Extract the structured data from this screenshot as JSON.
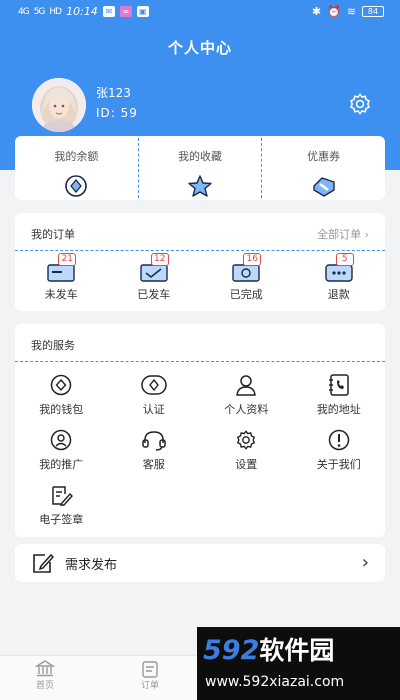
{
  "status_bar": {
    "signal_1": "4G",
    "signal_2": "5G",
    "badge_hd": "HD",
    "time": "10:14",
    "battery": "84"
  },
  "header": {
    "title": "个人中心",
    "username": "张123",
    "user_id": "ID: 59"
  },
  "quick_links": [
    {
      "label": "我的余额",
      "icon": "diamond-icon"
    },
    {
      "label": "我的收藏",
      "icon": "star-icon"
    },
    {
      "label": "优惠券",
      "icon": "coupon-icon"
    }
  ],
  "orders": {
    "title": "我的订单",
    "more": "全部订单",
    "items": [
      {
        "label": "未发车",
        "count": "21"
      },
      {
        "label": "已发车",
        "count": "12"
      },
      {
        "label": "已完成",
        "count": "16"
      },
      {
        "label": "退款",
        "count": "5"
      }
    ]
  },
  "services": {
    "title": "我的服务",
    "items": [
      {
        "label": "我的钱包",
        "icon": "wallet-icon"
      },
      {
        "label": "认证",
        "icon": "verify-icon"
      },
      {
        "label": "个人资料",
        "icon": "person-icon"
      },
      {
        "label": "我的地址",
        "icon": "address-book-icon"
      },
      {
        "label": "我的推广",
        "icon": "promotion-icon"
      },
      {
        "label": "客服",
        "icon": "headset-icon"
      },
      {
        "label": "设置",
        "icon": "gear-icon"
      },
      {
        "label": "关于我们",
        "icon": "info-icon"
      },
      {
        "label": "电子签章",
        "icon": "signature-icon"
      }
    ]
  },
  "publish": {
    "label": "需求发布"
  },
  "tabbar": {
    "tabs": [
      {
        "label": "首页"
      },
      {
        "label": "订单"
      }
    ]
  },
  "watermark": {
    "logo_num": "592",
    "logo_text": "软件园",
    "url": "www.592xiazai.com"
  },
  "colors": {
    "primary": "#3d8ff0",
    "badge": "#e24b4b",
    "background": "#f2f3f5"
  }
}
